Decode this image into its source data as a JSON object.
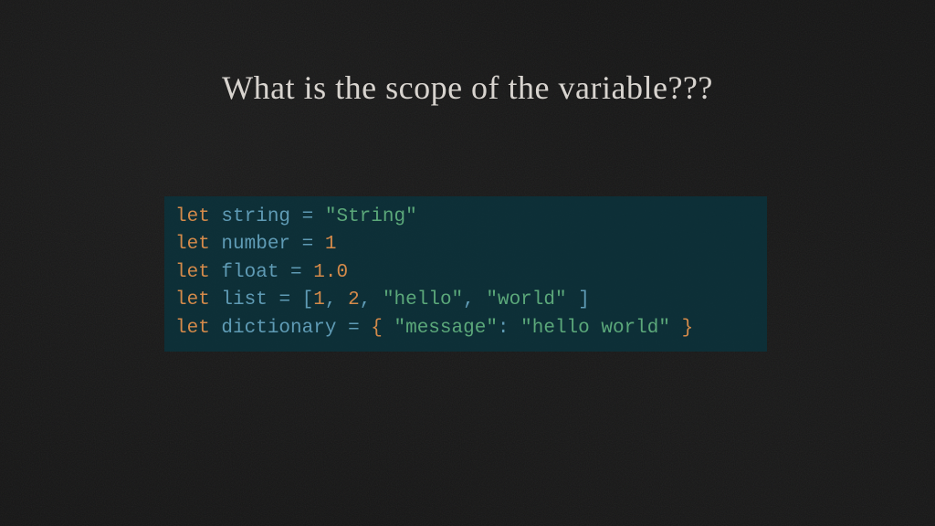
{
  "title": "What is the scope of the variable???",
  "code": {
    "line1": {
      "kw": "let",
      "sp1": " ",
      "ident": "string",
      "sp2": " ",
      "op": "=",
      "sp3": " ",
      "val": "\"String\""
    },
    "line2": {
      "kw": "let",
      "sp1": " ",
      "ident": "number",
      "sp2": " ",
      "op": "=",
      "sp3": " ",
      "val": "1"
    },
    "line3": {
      "kw": "let",
      "sp1": " ",
      "ident": "float",
      "sp2": " ",
      "op": "=",
      "sp3": " ",
      "val": "1.0"
    },
    "line4": {
      "kw": "let",
      "sp1": " ",
      "ident": "list",
      "sp2": " ",
      "op": "=",
      "sp3": " ",
      "lb": "[",
      "n1": "1",
      "c1": ",",
      "sp4": " ",
      "n2": "2",
      "c2": ",",
      "sp5": " ",
      "s1": "\"hello\"",
      "c3": ",",
      "sp6": " ",
      "s2": "\"world\"",
      "sp7": " ",
      "rb": "]"
    },
    "line5": {
      "kw": "let",
      "sp1": " ",
      "ident": "dictionary",
      "sp2": " ",
      "op": "=",
      "sp3": " ",
      "lb": "{",
      "sp4": " ",
      "key": "\"message\"",
      "colon": ":",
      "sp5": " ",
      "val": "\"hello world\"",
      "sp6": " ",
      "rb": "}"
    }
  }
}
